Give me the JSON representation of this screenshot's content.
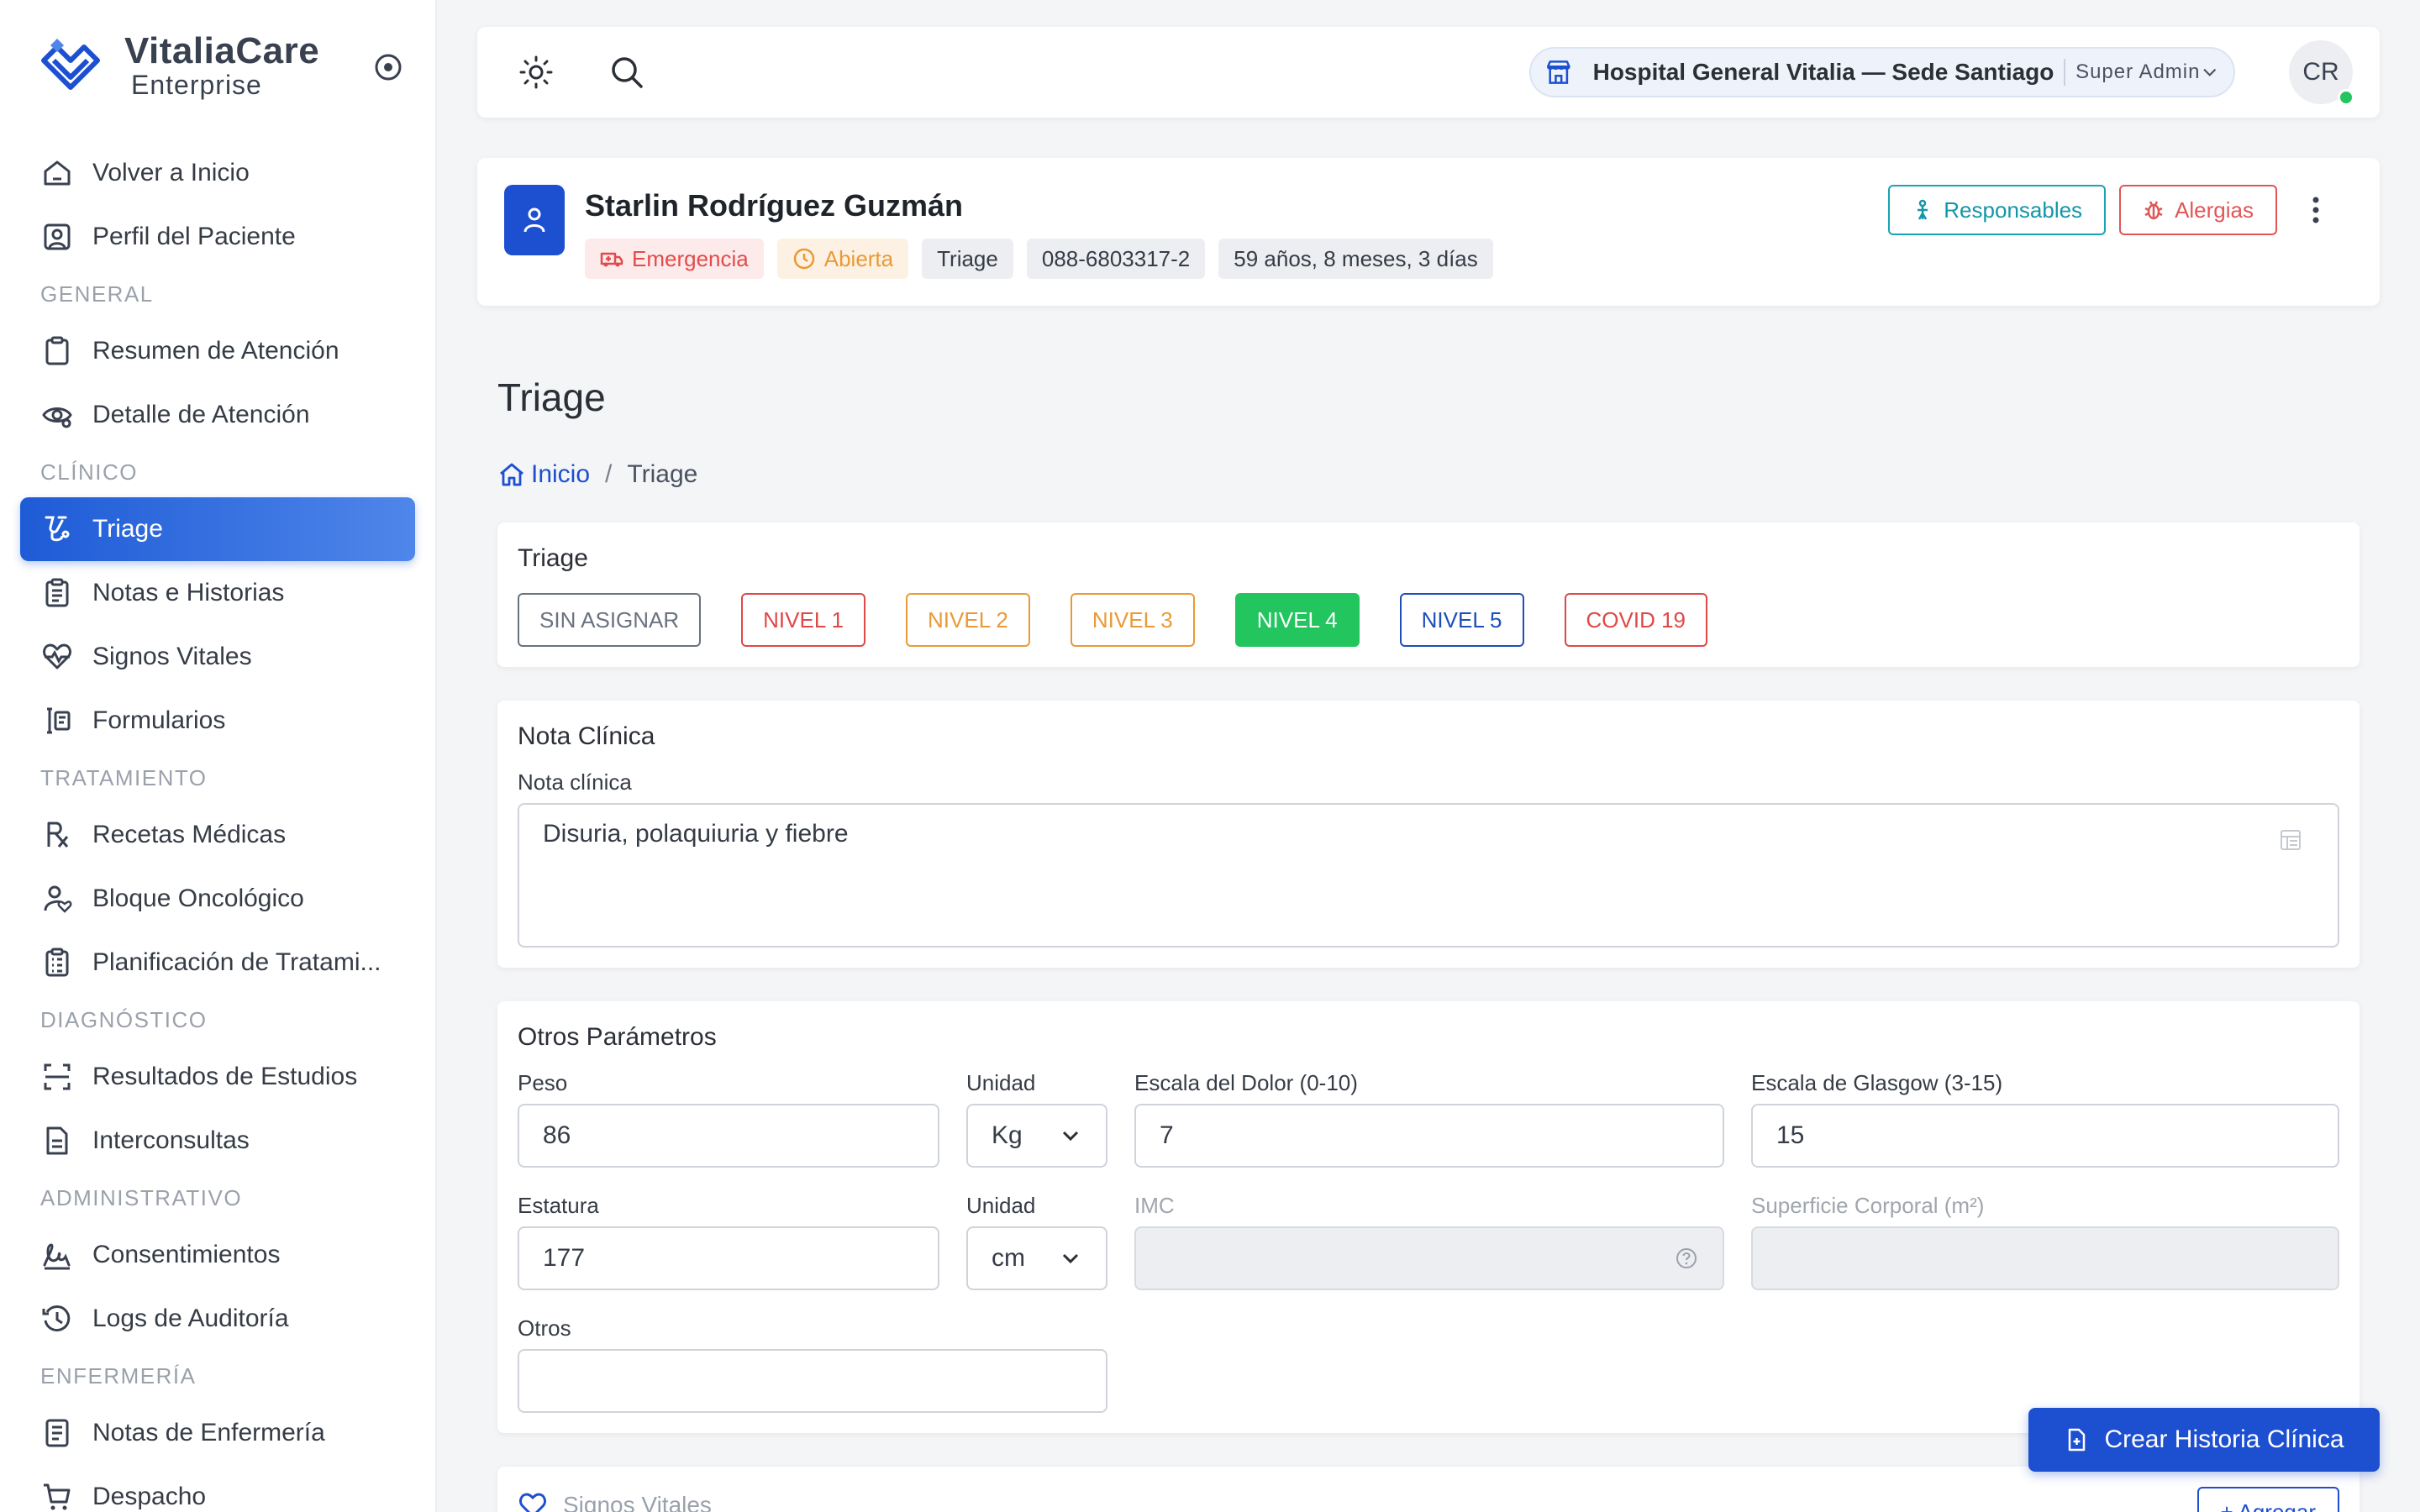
{
  "brand": {
    "name": "VitaliaCare",
    "sub": "Enterprise"
  },
  "sidebar": {
    "items": [
      {
        "label": "Volver a Inicio",
        "icon": "home-icon"
      },
      {
        "label": "Perfil del Paciente",
        "icon": "user-square-icon"
      }
    ],
    "sections": [
      {
        "title": "GENERAL",
        "items": [
          {
            "label": "Resumen de Atención",
            "icon": "clipboard-icon"
          },
          {
            "label": "Detalle de Atención",
            "icon": "eye-settings-icon"
          }
        ]
      },
      {
        "title": "CLÍNICO",
        "items": [
          {
            "label": "Triage",
            "icon": "stethoscope-icon",
            "active": true
          },
          {
            "label": "Notas e Historias",
            "icon": "clipboard-list-icon"
          },
          {
            "label": "Signos Vitales",
            "icon": "heart-pulse-icon"
          },
          {
            "label": "Formularios",
            "icon": "forms-icon"
          }
        ]
      },
      {
        "title": "TRATAMIENTO",
        "items": [
          {
            "label": "Recetas Médicas",
            "icon": "prescription-icon"
          },
          {
            "label": "Bloque Oncológico",
            "icon": "user-heart-icon"
          },
          {
            "label": "Planificación de Tratami...",
            "icon": "clipboard-check-icon"
          }
        ]
      },
      {
        "title": "DIAGNÓSTICO",
        "items": [
          {
            "label": "Resultados de Estudios",
            "icon": "scan-icon"
          },
          {
            "label": "Interconsultas",
            "icon": "document-icon"
          }
        ]
      },
      {
        "title": "ADMINISTRATIVO",
        "items": [
          {
            "label": "Consentimientos",
            "icon": "signature-icon"
          },
          {
            "label": "Logs de Auditoría",
            "icon": "history-icon"
          }
        ]
      },
      {
        "title": "ENFERMERÍA",
        "items": [
          {
            "label": "Notas de Enfermería",
            "icon": "notes-icon"
          },
          {
            "label": "Despacho",
            "icon": "cart-icon"
          }
        ]
      }
    ]
  },
  "topbar": {
    "hospital": "Hospital General Vitalia — Sede Santiago",
    "role": "Super Admin",
    "avatar_initials": "CR"
  },
  "patient": {
    "name": "Starlin Rodríguez Guzmán",
    "tags": {
      "type": "Emergencia",
      "status": "Abierta",
      "area": "Triage",
      "id": "088-6803317-2",
      "age": "59 años, 8 meses, 3 días"
    },
    "actions": {
      "responsables": "Responsables",
      "alergias": "Alergias"
    }
  },
  "page": {
    "title": "Triage",
    "breadcrumb": {
      "home": "Inicio",
      "current": "Triage"
    }
  },
  "triage": {
    "title": "Triage",
    "levels": [
      {
        "label": "SIN ASIGNAR",
        "color": "#6b7280",
        "selected": false
      },
      {
        "label": "NIVEL 1",
        "color": "#e04848",
        "selected": false
      },
      {
        "label": "NIVEL 2",
        "color": "#e99a36",
        "selected": false
      },
      {
        "label": "NIVEL 3",
        "color": "#e99a36",
        "selected": false
      },
      {
        "label": "NIVEL 4",
        "color": "#22c55e",
        "selected": true
      },
      {
        "label": "NIVEL 5",
        "color": "#1d4fb8",
        "selected": false
      },
      {
        "label": "COVID 19",
        "color": "#e04848",
        "selected": false
      }
    ]
  },
  "nota": {
    "title": "Nota Clínica",
    "label": "Nota clínica",
    "value": "Disuria, polaquiuria y fiebre"
  },
  "params": {
    "title": "Otros Parámetros",
    "peso_label": "Peso",
    "peso": "86",
    "unidad1_label": "Unidad",
    "unidad1": "Kg",
    "dolor_label": "Escala del Dolor (0-10)",
    "dolor": "7",
    "glasgow_label": "Escala de Glasgow (3-15)",
    "glasgow": "15",
    "estatura_label": "Estatura",
    "estatura": "177",
    "unidad2_label": "Unidad",
    "unidad2": "cm",
    "imc_label": "IMC",
    "superficie_label": "Superficie Corporal (m²)",
    "otros_label": "Otros",
    "otros": ""
  },
  "vitals": {
    "title": "Signos Vitales",
    "add_label": "+ Agregar"
  },
  "fab": {
    "label": "Crear Historia Clínica"
  },
  "colors": {
    "primary": "#1d4fd1",
    "accent_teal": "#1aa3b5",
    "danger": "#e05656",
    "warning": "#e99a36",
    "success": "#22c55e"
  }
}
